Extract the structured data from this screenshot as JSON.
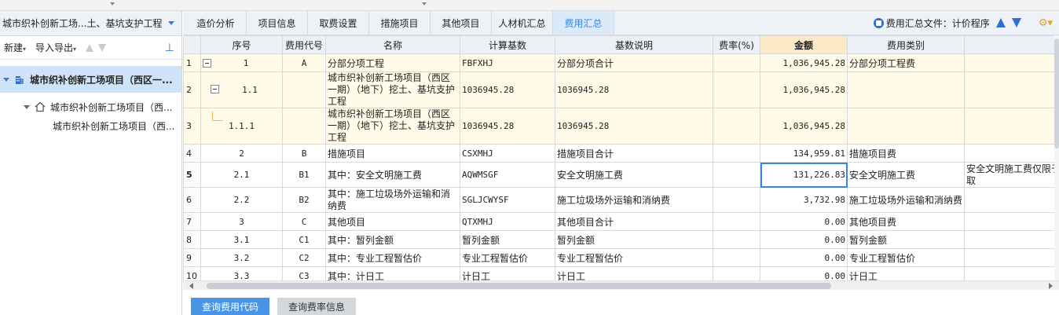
{
  "project": {
    "title": "城市织补创新工场...土、基坑支护工程",
    "toolbar": {
      "new_label": "新建",
      "import_label": "导入导出"
    }
  },
  "tree": {
    "root": "城市织补创新工场项目（西区一...",
    "level1": "城市织补创新工场项目（西...",
    "level2": "城市织补创新工场项目（西..."
  },
  "tabs": [
    {
      "label": "造价分析"
    },
    {
      "label": "项目信息"
    },
    {
      "label": "取费设置"
    },
    {
      "label": "措施项目"
    },
    {
      "label": "其他项目"
    },
    {
      "label": "人材机汇总"
    },
    {
      "label": "费用汇总"
    }
  ],
  "active_tab": "费用汇总",
  "summary_file": {
    "label": "费用汇总文件：",
    "value": "计价程序"
  },
  "table": {
    "headers": [
      "序号",
      "费用代号",
      "名称",
      "计算基数",
      "基数说明",
      "费率(%)",
      "金额",
      "费用类别"
    ],
    "rows": [
      {
        "rn": "1",
        "seq": "1",
        "code": "A",
        "name": "分部分项工程",
        "base": "FBFXHJ",
        "desc": "分部分项合计",
        "rate": "",
        "amount": "1,036,945.28",
        "category": "分部分项工程费",
        "extra": ""
      },
      {
        "rn": "2",
        "seq": "1.1",
        "code": "",
        "name": "城市织补创新工场项目（西区一期）（地下）挖土、基坑支护工程",
        "base": "1036945.28",
        "desc": "1036945.28",
        "rate": "",
        "amount": "1,036,945.28",
        "category": "",
        "extra": ""
      },
      {
        "rn": "3",
        "seq": "1.1.1",
        "code": "",
        "name": "城市织补创新工场项目（西区一期）（地下）挖土、基坑支护工程",
        "base": "1036945.28",
        "desc": "1036945.28",
        "rate": "",
        "amount": "1,036,945.28",
        "category": "",
        "extra": ""
      },
      {
        "rn": "4",
        "seq": "2",
        "code": "B",
        "name": "措施项目",
        "base": "CSXMHJ",
        "desc": "措施项目合计",
        "rate": "",
        "amount": "134,959.81",
        "category": "措施项目费",
        "extra": ""
      },
      {
        "rn": "5",
        "seq": "2.1",
        "code": "B1",
        "name": "其中：安全文明施工费",
        "base": "AQWMSGF",
        "desc": "安全文明施工费",
        "rate": "",
        "amount": "131,226.83",
        "category": "安全文明施工费",
        "extra": "安全文明施工费仅限于取"
      },
      {
        "rn": "6",
        "seq": "2.2",
        "code": "B2",
        "name": "其中：施工垃圾场外运输和消纳费",
        "base": "SGLJCWYSF",
        "desc": "施工垃圾场外运输和消纳费",
        "rate": "",
        "amount": "3,732.98",
        "category": "施工垃圾场外运输和消纳费",
        "extra": ""
      },
      {
        "rn": "7",
        "seq": "3",
        "code": "C",
        "name": "其他项目",
        "base": "QTXMHJ",
        "desc": "其他项目合计",
        "rate": "",
        "amount": "0.00",
        "category": "其他项目费",
        "extra": ""
      },
      {
        "rn": "8",
        "seq": "3.1",
        "code": "C1",
        "name": "其中：暂列金额",
        "base": "暂列金额",
        "desc": "暂列金额",
        "rate": "",
        "amount": "0.00",
        "category": "暂列金额",
        "extra": ""
      },
      {
        "rn": "9",
        "seq": "3.2",
        "code": "C2",
        "name": "其中：专业工程暂估价",
        "base": "专业工程暂估价",
        "desc": "专业工程暂估价",
        "rate": "",
        "amount": "0.00",
        "category": "专业工程暂估价",
        "extra": ""
      },
      {
        "rn": "10",
        "seq": "3.3",
        "code": "C3",
        "name": "其中：计日工",
        "base": "计日工",
        "desc": "计日工",
        "rate": "",
        "amount": "0.00",
        "category": "计日工",
        "extra": ""
      }
    ]
  },
  "bottom_tabs": [
    {
      "label": "查询费用代码"
    },
    {
      "label": "查询费率信息"
    }
  ],
  "colors": {
    "accent": "#3a86d8",
    "amount_header": "#fde9c8",
    "selected_row_bg": "#fffbe8"
  }
}
